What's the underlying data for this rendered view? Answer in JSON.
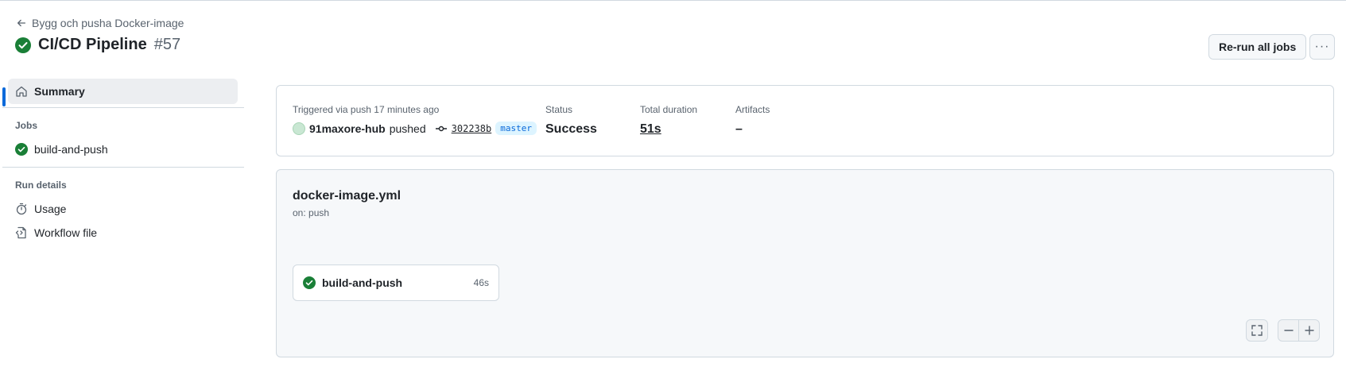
{
  "header": {
    "back_label": "Bygg och pusha Docker-image",
    "title": "CI/CD Pipeline",
    "run_number": "#57",
    "rerun_label": "Re-run all jobs",
    "more_label": "···"
  },
  "sidebar": {
    "summary_label": "Summary",
    "jobs_heading": "Jobs",
    "jobs": [
      {
        "label": "build-and-push",
        "status": "success"
      }
    ],
    "run_details_heading": "Run details",
    "usage_label": "Usage",
    "workflow_file_label": "Workflow file"
  },
  "summary": {
    "trigger_label": "Triggered via push 17 minutes ago",
    "user": "91maxore-hub",
    "action": "pushed",
    "commit_sha": "302238b",
    "branch": "master",
    "status_label": "Status",
    "status_value": "Success",
    "duration_label": "Total duration",
    "duration_value": "51s",
    "artifacts_label": "Artifacts",
    "artifacts_value": "–"
  },
  "workflow": {
    "filename": "docker-image.yml",
    "trigger": "on: push",
    "job_name": "build-and-push",
    "job_duration": "46s"
  },
  "colors": {
    "success": "#1a7f37",
    "accent": "#0969da",
    "border": "#d1d9e0",
    "muted_text": "#59636e"
  }
}
